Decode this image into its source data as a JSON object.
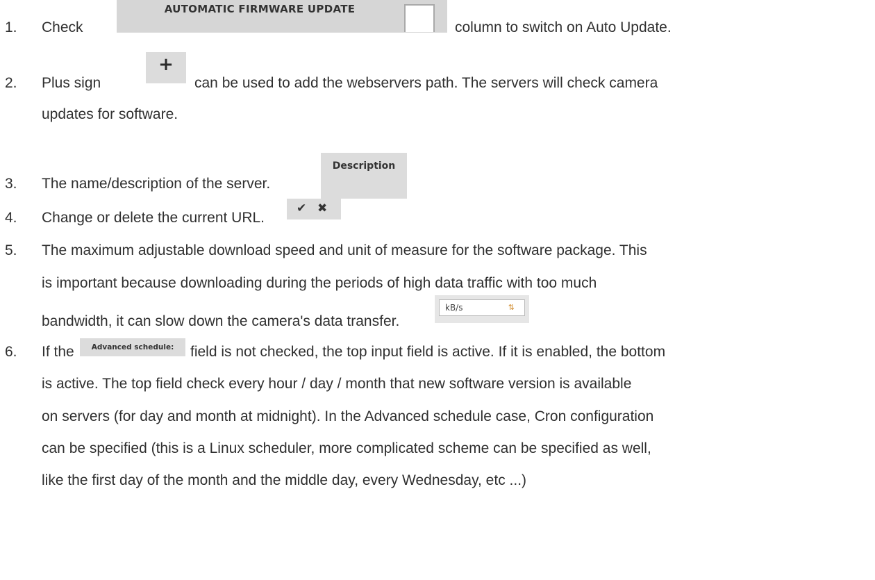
{
  "items": [
    {
      "number": "1.",
      "before": "Check",
      "after": "column to switch on Auto Update.",
      "snippet": {
        "label": "AUTOMATIC FIRMWARE UPDATE"
      }
    },
    {
      "number": "2.",
      "before": "Plus sign",
      "after": "can be used to add the webservers path. The servers will check camera",
      "line2": "updates for software.",
      "snippet": {
        "glyph": "+",
        "icon": "plus-icon"
      }
    },
    {
      "number": "3.",
      "before": "The name/description of the server.",
      "snippet": {
        "label": "Description"
      }
    },
    {
      "number": "4.",
      "before": "Change or delete the current URL.",
      "snippet": {
        "edit_glyph": "✔",
        "delete_glyph": "✖",
        "icons": [
          "edit-icon",
          "close-icon"
        ]
      }
    },
    {
      "number": "5.",
      "line1": "The maximum adjustable download speed and unit of measure for the software package. This",
      "line2": "is important because downloading during the periods of high data traffic with too much",
      "line3": "bandwidth, it can slow down the camera's data transfer.",
      "snippet": {
        "value": "kB/s",
        "arrows": "⇅"
      }
    },
    {
      "number": "6.",
      "before": "If the",
      "after": "field is not checked, the top input field is active. If it is enabled, the bottom",
      "snippet": {
        "label": "Advanced schedule:"
      },
      "lines": [
        "is active. The top field check every hour / day / month that new software version is available",
        "on servers (for day and month at midnight). In the Advanced schedule case, Cron configuration",
        "can be specified (this is a Linux scheduler, more complicated scheme can be specified as well,",
        "like the first day of the month and the middle day, every Wednesday, etc ...)"
      ]
    }
  ]
}
